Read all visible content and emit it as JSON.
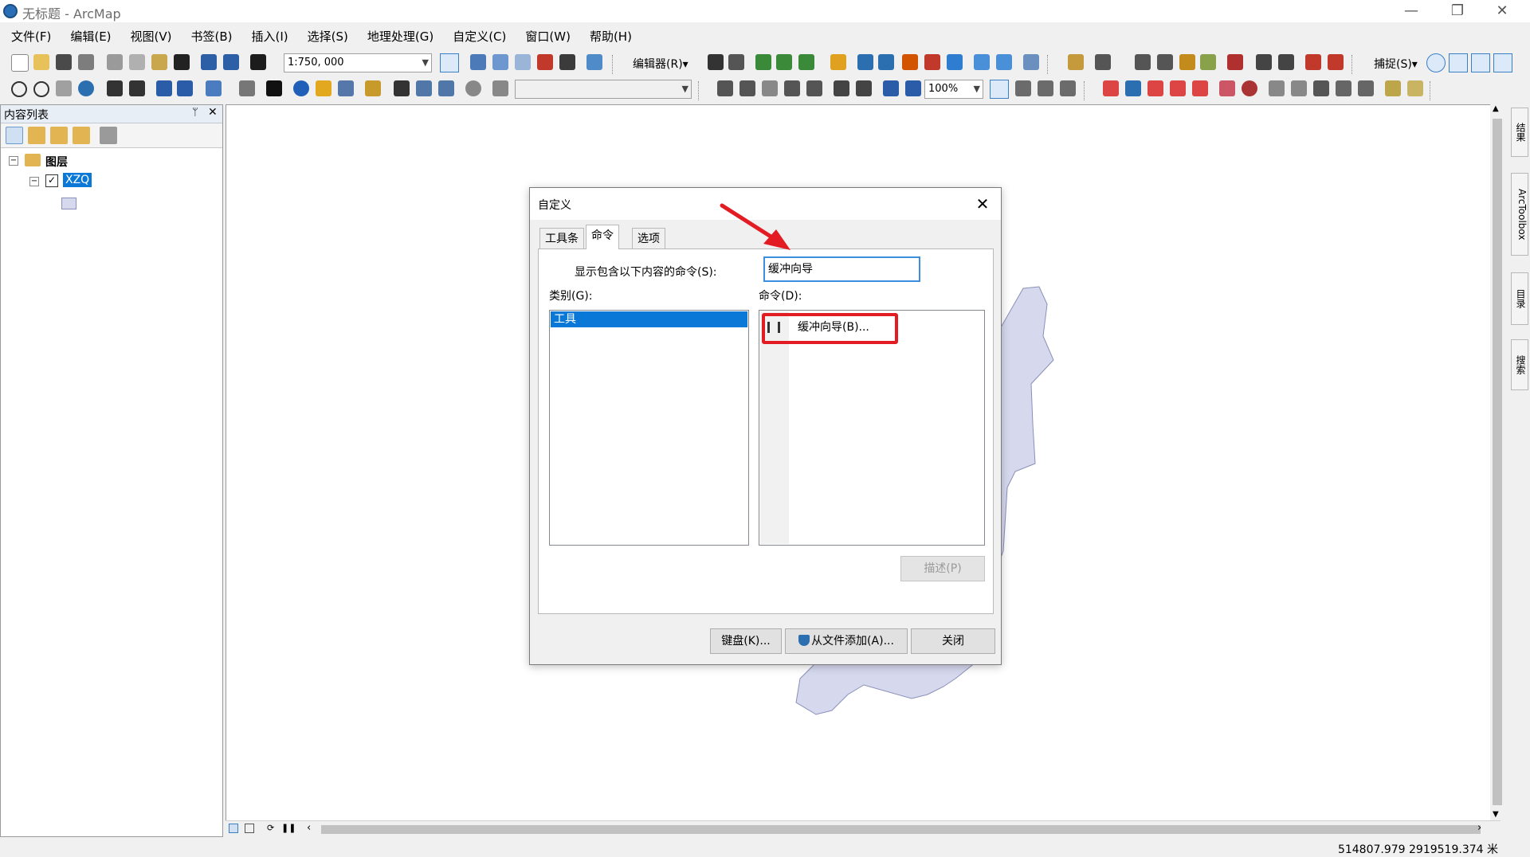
{
  "window": {
    "title": "无标题 - ArcMap",
    "controls": {
      "minimize": "—",
      "restore": "❐",
      "close": "✕"
    }
  },
  "menubar": {
    "items": [
      "文件(F)",
      "编辑(E)",
      "视图(V)",
      "书签(B)",
      "插入(I)",
      "选择(S)",
      "地理处理(G)",
      "自定义(C)",
      "窗口(W)",
      "帮助(H)"
    ]
  },
  "toolbar1": {
    "scale_value": "1:750, 000",
    "editor_label": "编辑器(R)▾",
    "snapping_label": "捕捉(S)▾"
  },
  "toolbar2": {
    "zoom_value": "100%"
  },
  "toc": {
    "title": "内容列表",
    "pin": "ᛘ",
    "close": "✕",
    "root_label": "图层",
    "layer_name": "XZQ"
  },
  "right_dock": {
    "tabs": [
      "结果",
      "ArcToolbox",
      "目录",
      "搜索"
    ]
  },
  "statusbar": {
    "coords": "514807.979  2919519.374 米"
  },
  "dialog": {
    "title": "自定义",
    "close": "✕",
    "tabs": [
      "工具条",
      "命令",
      "选项"
    ],
    "active_tab": "命令",
    "show_label": "显示包含以下内容的命令(S):",
    "search_value": "缓冲向导",
    "category_label": "类别(G):",
    "command_label": "命令(D):",
    "categories": [
      "工具"
    ],
    "commands": [
      "缓冲向导(B)..."
    ],
    "describe_button": "描述(P)",
    "keyboard_button": "键盘(K)...",
    "add_from_file_button": "从文件添加(A)...",
    "close_button": "关闭"
  },
  "colors": {
    "selection_blue": "#0a78d7",
    "annotation_red": "#e31b23",
    "polygon_fill": "#d6d8ee"
  }
}
